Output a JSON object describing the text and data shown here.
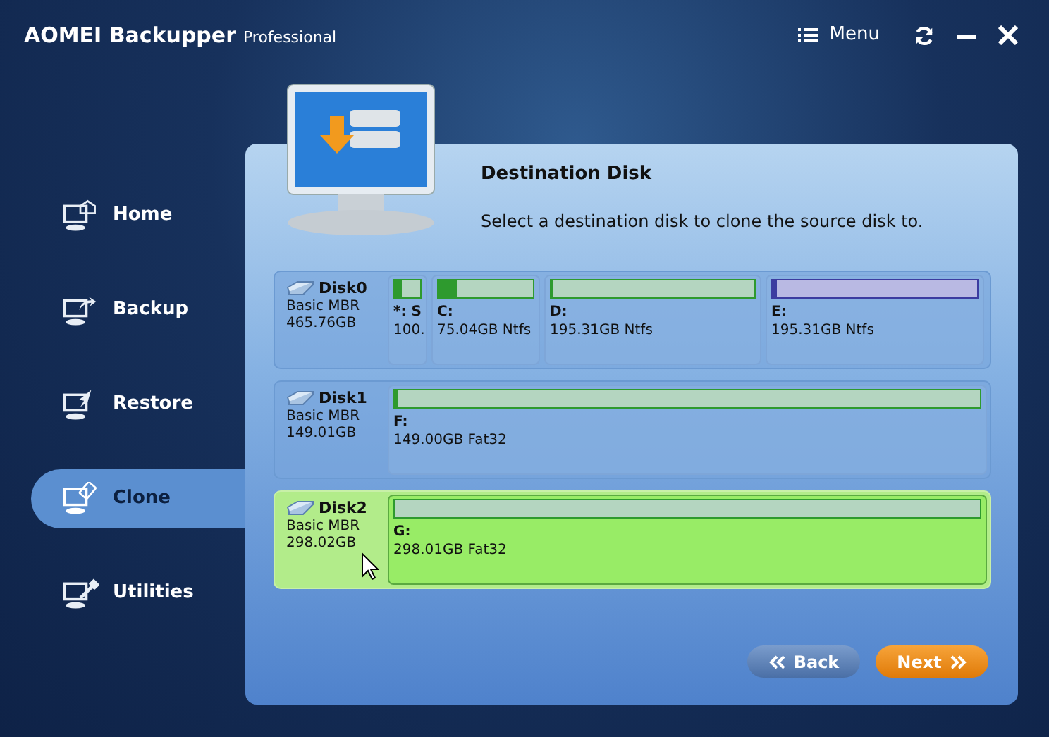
{
  "window": {
    "title": "AOMEI Backupper",
    "edition": "Professional",
    "menu_label": "Menu"
  },
  "sidebar": {
    "items": [
      {
        "label": "Home",
        "selected": false
      },
      {
        "label": "Backup",
        "selected": false
      },
      {
        "label": "Restore",
        "selected": false
      },
      {
        "label": "Clone",
        "selected": true
      },
      {
        "label": "Utilities",
        "selected": false
      }
    ]
  },
  "page": {
    "title": "Destination Disk",
    "subtitle": "Select a destination disk to clone the source disk to."
  },
  "disks": [
    {
      "name": "Disk0",
      "type": "Basic MBR",
      "size": "465.76GB",
      "selected": false,
      "partitions": [
        {
          "label": "*: S",
          "detail": "100.",
          "level": 0.3,
          "color": "#2e9a2e"
        },
        {
          "label": "C:",
          "detail": "75.04GB Ntfs",
          "level": 0.2,
          "color": "#2e9a2e"
        },
        {
          "label": "D:",
          "detail": "195.31GB Ntfs",
          "level": 0.01,
          "color": "#2e9a2e"
        },
        {
          "label": "E:",
          "detail": "195.31GB Ntfs",
          "level": 0.02,
          "color": "#3c3ca0"
        }
      ]
    },
    {
      "name": "Disk1",
      "type": "Basic MBR",
      "size": "149.01GB",
      "selected": false,
      "partitions": [
        {
          "label": "F:",
          "detail": "149.00GB Fat32",
          "level": 0.005,
          "color": "#2e9a2e"
        }
      ]
    },
    {
      "name": "Disk2",
      "type": "Basic MBR",
      "size": "298.02GB",
      "selected": true,
      "partitions": [
        {
          "label": "G:",
          "detail": "298.01GB Fat32",
          "level": 0,
          "color": "#2e9a2e"
        }
      ]
    }
  ],
  "buttons": [
    {
      "label": "Back",
      "kind": "back"
    },
    {
      "label": "Next",
      "kind": "next"
    }
  ]
}
